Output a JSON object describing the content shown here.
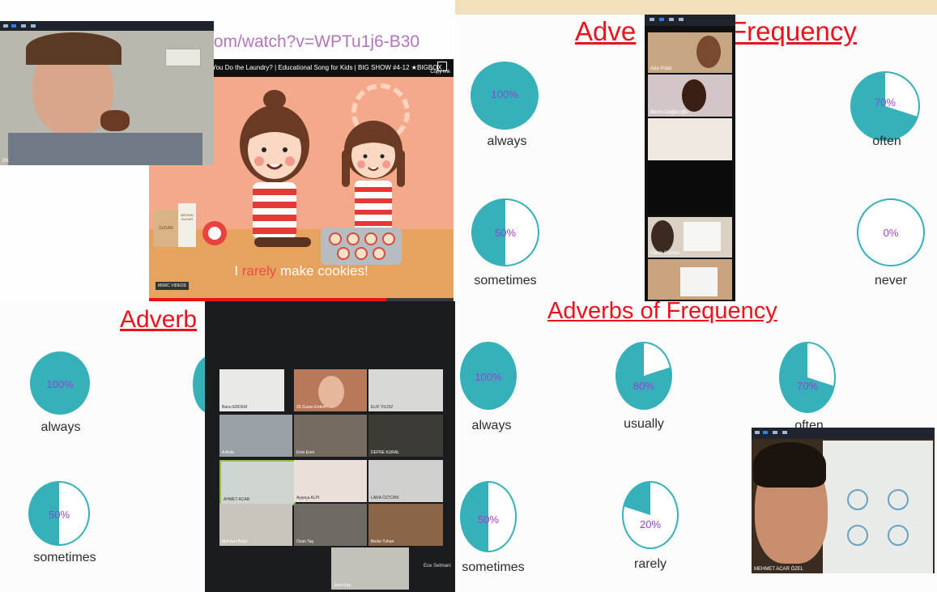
{
  "video": {
    "url_text": "tom/watch?v=WPTu1j6-B30",
    "title_text": "You Do the Laundry? | Educational Song for Kids | BIG SHOW #4-12 ★BIGBOX",
    "copy_link": "Copy link",
    "caption_pre": "I ",
    "caption_highlight": "rarely",
    "caption_post": " make cookies!",
    "logo_text": "MSRC VIDEOS",
    "jar_label_1": "SUGAR",
    "jar_label_2": "BROWN SUGAR"
  },
  "slide_top_right": {
    "title_left": "Adve",
    "title_right": "Frequency",
    "items": [
      {
        "pct": "100%",
        "label": "always",
        "value": 100
      },
      {
        "pct": "70%",
        "label": "often",
        "value": 70
      },
      {
        "pct": "50%",
        "label": "sometimes",
        "value": 50
      },
      {
        "pct": "0%",
        "label": "never",
        "value": 0
      }
    ]
  },
  "slide_bottom_left": {
    "title": "Adverb",
    "items": [
      {
        "pct": "100%",
        "label": "always",
        "value": 100
      },
      {
        "pct": "50%",
        "label": "sometimes",
        "value": 50
      }
    ]
  },
  "slide_bottom_right": {
    "title": "Adverbs of Frequency",
    "items": [
      {
        "pct": "100%",
        "label": "always",
        "value": 100
      },
      {
        "pct": "80%",
        "label": "usually",
        "value": 80
      },
      {
        "pct": "70%",
        "label": "often",
        "value": 70
      },
      {
        "pct": "50%",
        "label": "sometimes",
        "value": 50
      },
      {
        "pct": "20%",
        "label": "rarely",
        "value": 20
      }
    ]
  },
  "gallery_names": [
    "Banu ERDEM",
    "20 Zuzan Erdem",
    "ELIF YILDIZ",
    "",
    "A Arda",
    "Emir Eren",
    "DEFNE KURAL",
    "",
    "AHMET ACAR",
    "Ayşeça ALPI",
    "LARA ÖZTÜRK",
    "",
    "Mehmet Bulut",
    "Ozan Taş",
    "Berke Tuhan",
    "",
    "John Kaş",
    "Ece Selmani"
  ],
  "strip_names": [
    "Ada Polat",
    "Beren Dağlaroğlu",
    "",
    "",
    "Havin Gamze",
    ""
  ],
  "cam_bottom_label": "MEHMET ACAR ÖZEL",
  "colors": {
    "pie": "#36b0b9",
    "pct_text": "#9b3fd6",
    "title": "#e8141c"
  }
}
